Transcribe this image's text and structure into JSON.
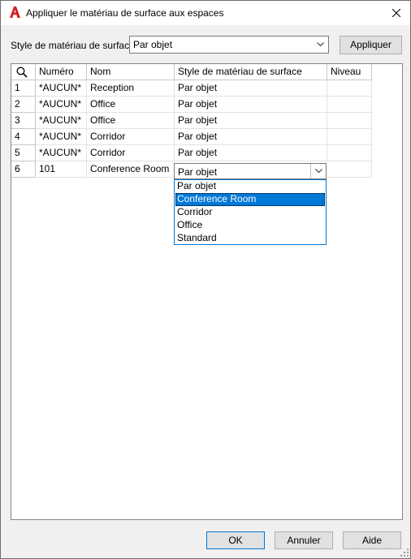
{
  "window": {
    "title": "Appliquer le matériau de surface aux espaces"
  },
  "toolbar": {
    "style_label": "Style de matériau de surface:",
    "style_value": "Par objet",
    "apply_label": "Appliquer"
  },
  "grid": {
    "columns": [
      "Numéro",
      "Nom",
      "Style de matériau de surface",
      "Niveau"
    ],
    "rows": [
      {
        "index": "1",
        "numero": "*AUCUN*",
        "nom": "Reception",
        "style": "Par objet",
        "niveau": ""
      },
      {
        "index": "2",
        "numero": "*AUCUN*",
        "nom": "Office",
        "style": "Par objet",
        "niveau": ""
      },
      {
        "index": "3",
        "numero": "*AUCUN*",
        "nom": "Office",
        "style": "Par objet",
        "niveau": ""
      },
      {
        "index": "4",
        "numero": "*AUCUN*",
        "nom": "Corridor",
        "style": "Par objet",
        "niveau": ""
      },
      {
        "index": "5",
        "numero": "*AUCUN*",
        "nom": "Corridor",
        "style": "Par objet",
        "niveau": ""
      },
      {
        "index": "6",
        "numero": "101",
        "nom": "Conference Room",
        "style": "Par objet",
        "niveau": ""
      }
    ],
    "editor_value": "Par objet",
    "dropdown_options": [
      "Par objet",
      "Conference Room",
      "Corridor",
      "Office",
      "Standard"
    ],
    "dropdown_selected": "Conference Room"
  },
  "footer": {
    "ok_label": "OK",
    "cancel_label": "Annuler",
    "help_label": "Aide"
  },
  "colors": {
    "accent": "#0078d7",
    "app_icon": "#d42027"
  },
  "icons": [
    "app-logo-icon",
    "close-icon",
    "chevron-down-icon",
    "search-icon",
    "resize-grip-icon"
  ]
}
